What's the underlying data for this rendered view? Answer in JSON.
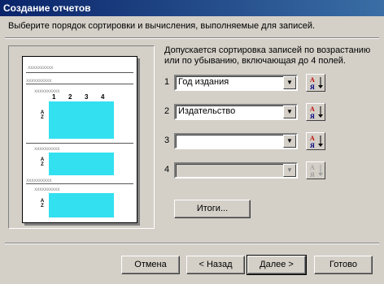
{
  "window": {
    "title": "Создание отчетов"
  },
  "header": {
    "instruction": "Выберите порядок сортировки и вычисления, выполняемые для записей."
  },
  "preview": {
    "placeholder": "xxxxxxxxxx",
    "column_numbers": [
      "1",
      "2",
      "3",
      "4"
    ],
    "sort_az_label": "A Z"
  },
  "sort": {
    "description": "Допускается сортировка записей по возрастанию или по убыванию, включающая до 4 полей.",
    "rows": [
      {
        "num": "1",
        "value": "Год издания",
        "enabled": true
      },
      {
        "num": "2",
        "value": "Издательство",
        "enabled": true
      },
      {
        "num": "3",
        "value": "",
        "enabled": true
      },
      {
        "num": "4",
        "value": "",
        "enabled": false
      }
    ]
  },
  "buttons": {
    "summary": "Итоги...",
    "cancel": "Отмена",
    "back": "< Назад",
    "next": "Далее >",
    "finish": "Готово"
  },
  "colors": {
    "preview_highlight": "#33e0f0",
    "title_bar": "#0a246a"
  }
}
